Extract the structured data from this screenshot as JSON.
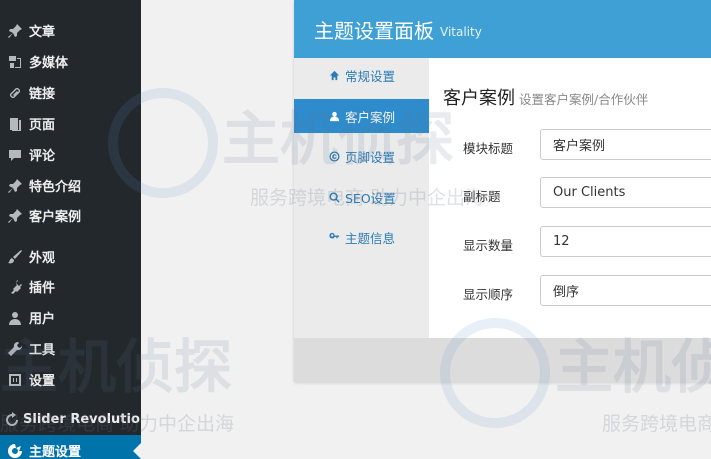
{
  "sidebar": {
    "items": [
      {
        "label": "文章",
        "icon": "pin-icon"
      },
      {
        "label": "多媒体",
        "icon": "media-icon"
      },
      {
        "label": "链接",
        "icon": "link-icon"
      },
      {
        "label": "页面",
        "icon": "page-icon"
      },
      {
        "label": "评论",
        "icon": "comment-icon"
      },
      {
        "label": "特色介绍",
        "icon": "pin-icon"
      },
      {
        "label": "客户案例",
        "icon": "pin-icon"
      },
      {
        "label": "外观",
        "icon": "brush-icon"
      },
      {
        "label": "插件",
        "icon": "plugin-icon"
      },
      {
        "label": "用户",
        "icon": "user-icon"
      },
      {
        "label": "工具",
        "icon": "wrench-icon"
      },
      {
        "label": "设置",
        "icon": "settings-icon"
      },
      {
        "label": "Slider Revolution",
        "icon": "refresh-icon"
      },
      {
        "label": "主题设置",
        "icon": "theme-icon",
        "active": true
      }
    ]
  },
  "panel": {
    "title": "主题设置面板",
    "subtitle": "Vitality",
    "tabs": [
      {
        "label": "常规设置",
        "icon": "home-icon"
      },
      {
        "label": "客户案例",
        "icon": "user-icon",
        "active": true
      },
      {
        "label": "页脚设置",
        "icon": "copyright-icon"
      },
      {
        "label": "SEO设置",
        "icon": "search-icon"
      },
      {
        "label": "主题信息",
        "icon": "key-icon"
      }
    ],
    "section": {
      "title": "客户案例",
      "subtitle": "设置客户案例/合作伙伴",
      "fields": [
        {
          "label": "模块标题",
          "value": "客户案例"
        },
        {
          "label": "副标题",
          "value": "Our Clients"
        },
        {
          "label": "显示数量",
          "value": "12"
        },
        {
          "label": "显示顺序",
          "value": "倒序"
        }
      ]
    }
  },
  "watermark": {
    "brand": "主机侦探",
    "slogan": "服务跨境电商 助力中企出海"
  },
  "colors": {
    "sidebar_bg": "#23282d",
    "sidebar_active": "#0073aa",
    "header_blue": "#3ea0d4",
    "tab_active": "#2e8ccd"
  }
}
